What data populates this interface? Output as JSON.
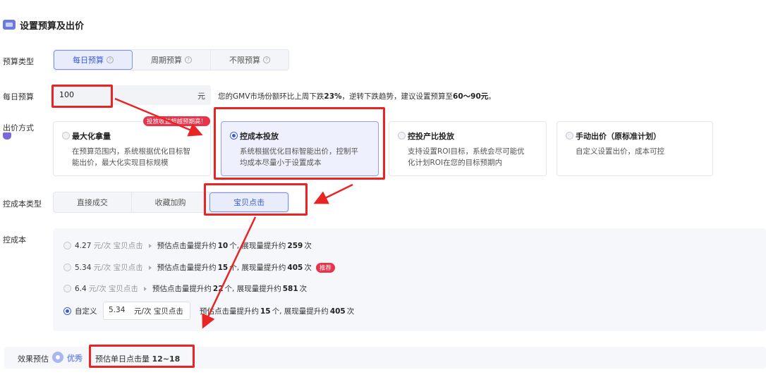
{
  "header": {
    "title": "设置预算及出价"
  },
  "budget_type": {
    "label": "预算类型",
    "options": [
      {
        "label": "每日预算",
        "active": true
      },
      {
        "label": "周期预算",
        "active": false
      },
      {
        "label": "不限预算",
        "active": false
      }
    ],
    "help_icon": "?"
  },
  "daily_budget": {
    "label": "每日预算",
    "value": "100",
    "unit": "元",
    "hint_pre": "您的GMV市场份额环比上周下跌",
    "hint_pct": "23%",
    "hint_mid": "，逆转下跌趋势，建议设置预算至",
    "hint_range": "60～90元",
    "hint_end": "。"
  },
  "bid_method": {
    "label": "出价方式",
    "tag": "投放收益超越预期高！",
    "cards": [
      {
        "title": "最大化拿量",
        "desc1": "在预算范围内，系统根据优化目标智",
        "desc2": "能出价，最大化实现目标规模",
        "selected": false
      },
      {
        "title": "控成本投放",
        "desc1": "系统根据优化目标智能出价，控制平",
        "desc2": "均成本尽量小于设置成本",
        "selected": true
      },
      {
        "title": "控投产比投放",
        "desc1": "支持设置ROI目标，系统会尽可能优",
        "desc2": "化计划ROI在您的目标预期内",
        "selected": false
      },
      {
        "title": "手动出价（原标准计划）",
        "desc1": "自定义设置出价，成本可控",
        "desc2": "",
        "selected": false
      }
    ]
  },
  "cost_type": {
    "label": "控成本类型",
    "options": [
      {
        "label": "直接成交",
        "active": false
      },
      {
        "label": "收藏加购",
        "active": false
      },
      {
        "label": "宝贝点击",
        "active": true
      }
    ]
  },
  "cost": {
    "label": "控成本",
    "options": [
      {
        "price": "4.27",
        "unit": "元/次 宝贝点击",
        "pre": "预估点击量提升约",
        "clicks": "10",
        "mid": "个, 展现量提升约",
        "views": "259",
        "post": "次",
        "recommend": false
      },
      {
        "price": "5.34",
        "unit": "元/次 宝贝点击",
        "pre": "预估点击量提升约",
        "clicks": "15",
        "mid": "个, 展现量提升约",
        "views": "405",
        "post": "次",
        "recommend": true
      },
      {
        "price": "6.4",
        "unit": "元/次 宝贝点击",
        "pre": "预估点击量提升约",
        "clicks": "22",
        "mid": "个, 展现量提升约",
        "views": "581",
        "post": "次",
        "recommend": false
      }
    ],
    "recommend_tag": "推荐",
    "custom": {
      "label": "自定义",
      "value": "5.34",
      "unit": "元/次 宝贝点击",
      "pre": "预估点击量提升约",
      "clicks": "15",
      "mid": "个, 展现量提升约",
      "views": "405",
      "post": "次"
    }
  },
  "effect": {
    "label": "效果预估",
    "grade": "优秀",
    "est_label": "预估单日点击量",
    "est_value": "12~18"
  },
  "colors": {
    "accent": "#3b5bdb",
    "annotation": "#e82424"
  }
}
